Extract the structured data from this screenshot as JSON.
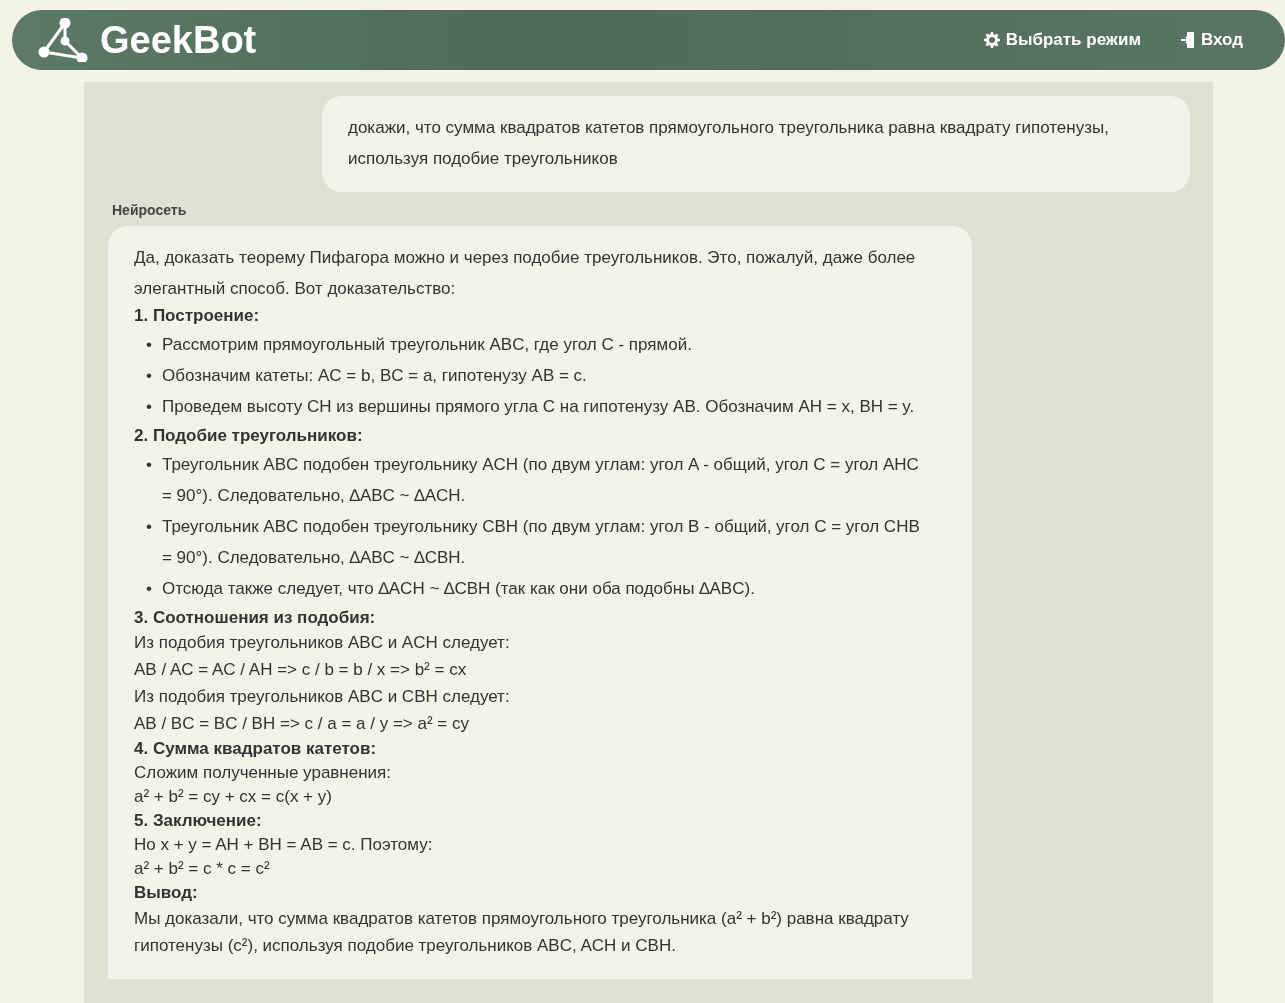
{
  "header": {
    "title": "GeekBot",
    "actions": [
      {
        "kind": "mode",
        "label": "Выбрать режим"
      },
      {
        "kind": "login",
        "label": "Вход"
      }
    ]
  },
  "chat": {
    "user_message": "докажи, что сумма квадратов катетов прямоугольного треугольника равна квадрату гипотенузы, используя подобие треугольников",
    "bot_name": "Нейросеть",
    "bot_blocks": [
      {
        "kind": "paragraph",
        "text": "Да, доказать теорему Пифагора можно и через подобие треугольников. Это, пожалуй, даже более элегантный способ. Вот доказательство:"
      },
      {
        "kind": "heading",
        "text": "1. Построение:"
      },
      {
        "kind": "list",
        "marker": "•",
        "items": [
          "Рассмотрим прямоугольный треугольник ABC, где угол C - прямой.",
          "Обозначим катеты: AC = b, BC = a, гипотенузу AB = c.",
          "Проведем высоту CH из вершины прямого угла C на гипотенузу AB.  Обозначим AH = x, BH = y."
        ]
      },
      {
        "kind": "heading",
        "text": "2. Подобие треугольников:"
      },
      {
        "kind": "list",
        "marker": "•",
        "items": [
          "Треугольник ABC подобен треугольнику ACH (по двум углам: угол A - общий, угол C = угол AHC = 90°). Следовательно, ∆ABC ~ ∆ACH.",
          "Треугольник ABC подобен треугольнику CBH (по двум углам: угол B - общий, угол C = угол CHB = 90°). Следовательно, ∆ABC ~ ∆CBH.",
          "Отсюда также следует, что ∆ACH ~ ∆CBH (так как они оба подобны ∆ABC)."
        ]
      },
      {
        "kind": "heading",
        "text": "3. Соотношения из подобия:"
      },
      {
        "kind": "line",
        "text": "Из подобия треугольников ABC и ACH следует:"
      },
      {
        "kind": "line",
        "text": "AB / AC = AC / AH  =>  c / b = b / x  =>  b² = cx"
      },
      {
        "kind": "line",
        "text": "Из подобия треугольников ABC и CBH следует:"
      },
      {
        "kind": "line",
        "text": "AB / BC = BC / BH  =>  c / a = a / y  =>  a² = cy"
      },
      {
        "kind": "heading_compact",
        "text": "4. Сумма квадратов катетов:"
      },
      {
        "kind": "line_tight",
        "text": "Сложим полученные уравнения:"
      },
      {
        "kind": "line_tight",
        "text": "a² + b² = cy + cx = c(x + y)"
      },
      {
        "kind": "heading_compact",
        "text": "5. Заключение:"
      },
      {
        "kind": "line_tight",
        "text": "Но x + y = AH + BH = AB = c.  Поэтому:"
      },
      {
        "kind": "line_tight",
        "text": "a² + b² = c * c = c²"
      },
      {
        "kind": "heading_compact",
        "text": "Вывод:"
      },
      {
        "kind": "paragraph_compact",
        "text": "Мы доказали, что сумма квадратов катетов прямоугольного треугольника (a² + b²) равна квадрату гипотенузы (c²), используя подобие треугольников ABC, ACH и CBH."
      }
    ]
  }
}
